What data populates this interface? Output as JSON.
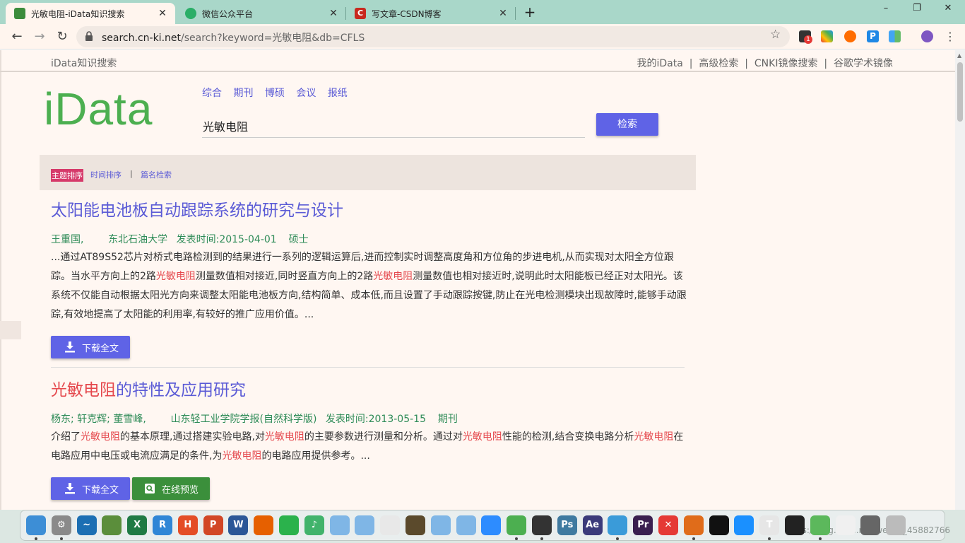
{
  "browser": {
    "tabs": [
      {
        "title": "光敏电阻-iData知识搜索",
        "favicon_color": "#3c8c3c",
        "active": true
      },
      {
        "title": "微信公众平台",
        "favicon_color": "#2aae67",
        "active": false
      },
      {
        "title": "写文章-CSDN博客",
        "favicon_color": "#c8291f",
        "active": false
      }
    ],
    "new_tab_label": "+",
    "url_host": "search.cn-ki.net",
    "url_path": "/search?keyword=光敏电阻&db=CFLS",
    "window": {
      "minimize": "–",
      "restore": "❐",
      "close": "✕"
    }
  },
  "topnav": {
    "brand": "iData知识搜索",
    "links": [
      "我的iData",
      "高级检索",
      "CNKI镜像搜索",
      "谷歌学术镜像"
    ]
  },
  "logo": "iData",
  "categories": [
    "综合",
    "期刊",
    "博硕",
    "会议",
    "报纸"
  ],
  "search": {
    "value": "光敏电阻",
    "button": "检索"
  },
  "sort": {
    "active": "主题排序",
    "time": "时间排序",
    "separator": "|",
    "title": "篇名检索"
  },
  "results": [
    {
      "title_pre": "太阳能电池板自动跟踪系统的研究与设计",
      "title_hl": "",
      "title_post": "",
      "authors": "王重国,",
      "institution": "东北石油大学",
      "date_label": "发表时间:",
      "date": "2015-04-01",
      "type": "硕士",
      "abstract": [
        {
          "t": "...通过AT89S52芯片对桥式电路检测到的结果进行一系列的逻辑运算后,进而控制实时调整高度角和方位角的步进电机,从而实现对太阳全方位跟踪。当水平方向上的2路",
          "h": false
        },
        {
          "t": "光敏电阻",
          "h": true
        },
        {
          "t": "测量数值相对接近,同时竖直方向上的2路",
          "h": false
        },
        {
          "t": "光敏电阻",
          "h": true
        },
        {
          "t": "测量数值也相对接近时,说明此时太阳能板已经正对太阳光。该系统不仅能自动根据太阳光方向来调整太阳能电池板方向,结构简单、成本低,而且设置了手动跟踪按键,防止在光电检测模块出现故障时,能够手动跟踪,有效地提高了太阳能的利用率,有较好的推广应用价值。...",
          "h": false
        }
      ],
      "download_label": "下载全文",
      "preview_label": ""
    },
    {
      "title_pre": "",
      "title_hl": "光敏电阻",
      "title_post": "的特性及应用研究",
      "authors": "杨东; 轩克辉; 董雪峰,",
      "institution": "山东轻工业学院学报(自然科学版)",
      "date_label": "发表时间:",
      "date": "2013-05-15",
      "type": "期刊",
      "abstract": [
        {
          "t": "介绍了",
          "h": false
        },
        {
          "t": "光敏电阻",
          "h": true
        },
        {
          "t": "的基本原理,通过搭建实验电路,对",
          "h": false
        },
        {
          "t": "光敏电阻",
          "h": true
        },
        {
          "t": "的主要参数进行测量和分析。通过对",
          "h": false
        },
        {
          "t": "光敏电阻",
          "h": true
        },
        {
          "t": "性能的检测,结合变换电路分析",
          "h": false
        },
        {
          "t": "光敏电阻",
          "h": true
        },
        {
          "t": "在电路应用中电压或电流应满足的条件,为",
          "h": false
        },
        {
          "t": "光敏电阻",
          "h": true
        },
        {
          "t": "的电路应用提供参考。...",
          "h": false
        }
      ],
      "download_label": "下载全文",
      "preview_label": "在线预览"
    }
  ],
  "taskbar": {
    "icons": [
      {
        "name": "finder",
        "color": "#3d8ed6",
        "glyph": ""
      },
      {
        "name": "settings",
        "color": "#8a8a8a",
        "glyph": "⚙"
      },
      {
        "name": "activity-monitor",
        "color": "#1c6fb3",
        "glyph": "~"
      },
      {
        "name": "photos",
        "color": "#5b8e3b",
        "glyph": ""
      },
      {
        "name": "excel",
        "color": "#1f7a44",
        "glyph": "X"
      },
      {
        "name": "r-app",
        "color": "#2f86d6",
        "glyph": "R"
      },
      {
        "name": "h-app",
        "color": "#e44d26",
        "glyph": "H"
      },
      {
        "name": "powerpoint",
        "color": "#d24726",
        "glyph": "P"
      },
      {
        "name": "word",
        "color": "#2b5797",
        "glyph": "W"
      },
      {
        "name": "firefox",
        "color": "#e66000",
        "glyph": ""
      },
      {
        "name": "sprout-app",
        "color": "#2bb24c",
        "glyph": ""
      },
      {
        "name": "music-app",
        "color": "#41b36b",
        "glyph": "♪"
      },
      {
        "name": "folder",
        "color": "#7fb6e6",
        "glyph": ""
      },
      {
        "name": "folder-2",
        "color": "#7fb6e6",
        "glyph": ""
      },
      {
        "name": "terminal-app",
        "color": "#e8e8e8",
        "glyph": ""
      },
      {
        "name": "media-app",
        "color": "#5b4a2c",
        "glyph": ""
      },
      {
        "name": "folder-3",
        "color": "#7fb6e6",
        "glyph": ""
      },
      {
        "name": "folder-4",
        "color": "#7fb6e6",
        "glyph": ""
      },
      {
        "name": "zoom",
        "color": "#2d8cff",
        "glyph": ""
      },
      {
        "name": "chrome",
        "color": "#4caf50",
        "glyph": ""
      },
      {
        "name": "wechat",
        "color": "#333333",
        "glyph": ""
      },
      {
        "name": "photoshop",
        "color": "#3f7aa0",
        "glyph": "Ps"
      },
      {
        "name": "after-effects",
        "color": "#3b3a7a",
        "glyph": "Ae"
      },
      {
        "name": "qq",
        "color": "#3a9bd9",
        "glyph": ""
      },
      {
        "name": "premiere",
        "color": "#3a1f4f",
        "glyph": "Pr"
      },
      {
        "name": "xmind",
        "color": "#e53935",
        "glyph": "✕"
      },
      {
        "name": "matlab",
        "color": "#e06c1a",
        "glyph": ""
      },
      {
        "name": "record-app",
        "color": "#111111",
        "glyph": ""
      },
      {
        "name": "dingtalk",
        "color": "#1a90ff",
        "glyph": ""
      },
      {
        "name": "typora",
        "color": "#e6e6e6",
        "glyph": "T"
      },
      {
        "name": "display-app",
        "color": "#222222",
        "glyph": ""
      },
      {
        "name": "bubbles-app",
        "color": "#5cb85c",
        "glyph": ""
      },
      {
        "name": "document-app",
        "color": "#f0f0f0",
        "glyph": ""
      },
      {
        "name": "calculator",
        "color": "#666666",
        "glyph": ""
      },
      {
        "name": "trash",
        "color": "#bbbbbb",
        "glyph": ""
      }
    ]
  }
}
